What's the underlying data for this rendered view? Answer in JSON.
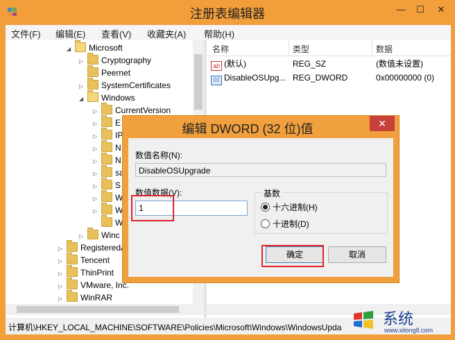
{
  "window": {
    "title": "注册表编辑器",
    "minimize": "—",
    "maximize": "☐",
    "close": "✕"
  },
  "menu": [
    "文件(F)",
    "编辑(E)",
    "查看(V)",
    "收藏夹(A)",
    "帮助(H)"
  ],
  "tree": [
    {
      "label": "Microsoft",
      "level": 0,
      "expanded": true
    },
    {
      "label": "Cryptography",
      "level": 1,
      "expanded": false
    },
    {
      "label": "Peernet",
      "level": 1,
      "expanded": null
    },
    {
      "label": "SystemCertificates",
      "level": 1,
      "expanded": false
    },
    {
      "label": "Windows",
      "level": 1,
      "expanded": true
    },
    {
      "label": "CurrentVersion",
      "level": 2,
      "expanded": false
    },
    {
      "label": "E",
      "level": 2,
      "expanded": false
    },
    {
      "label": "IP",
      "level": 2,
      "expanded": false
    },
    {
      "label": "N",
      "level": 2,
      "expanded": false
    },
    {
      "label": "N",
      "level": 2,
      "expanded": false
    },
    {
      "label": "sa",
      "level": 2,
      "expanded": false
    },
    {
      "label": "S",
      "level": 2,
      "expanded": false
    },
    {
      "label": "W",
      "level": 2,
      "expanded": false
    },
    {
      "label": "W",
      "level": 2,
      "expanded": false
    },
    {
      "label": "W",
      "level": 2,
      "expanded": null
    },
    {
      "label": "Winc",
      "level": 1,
      "expanded": false
    },
    {
      "label": "RegisteredA",
      "level": -1,
      "expanded": false
    },
    {
      "label": "Tencent",
      "level": -1,
      "expanded": false
    },
    {
      "label": "ThinPrint",
      "level": -1,
      "expanded": false
    },
    {
      "label": "VMware, Inc.",
      "level": -1,
      "expanded": false
    },
    {
      "label": "WinRAR",
      "level": -1,
      "expanded": false
    }
  ],
  "list": {
    "headers": [
      "名称",
      "类型",
      "数据"
    ],
    "rows": [
      {
        "icon": "ab",
        "name": "(默认)",
        "type": "REG_SZ",
        "data": "(数值未设置)"
      },
      {
        "icon": "bin",
        "name": "DisableOSUpg...",
        "type": "REG_DWORD",
        "data": "0x00000000 (0)"
      }
    ]
  },
  "status": "计算机\\HKEY_LOCAL_MACHINE\\SOFTWARE\\Policies\\Microsoft\\Windows\\WindowsUpda",
  "dialog": {
    "title": "编辑 DWORD (32 位)值",
    "close": "✕",
    "name_label": "数值名称(N):",
    "name_value": "DisableOSUpgrade",
    "data_label": "数值数据(V):",
    "data_value": "1",
    "base_label": "基数",
    "hex_label": "十六进制(H)",
    "dec_label": "十进制(D)",
    "selected_base": "hex",
    "ok": "确定",
    "cancel": "取消"
  },
  "watermark": {
    "text": "系统",
    "url": "www.xitong8.com"
  }
}
